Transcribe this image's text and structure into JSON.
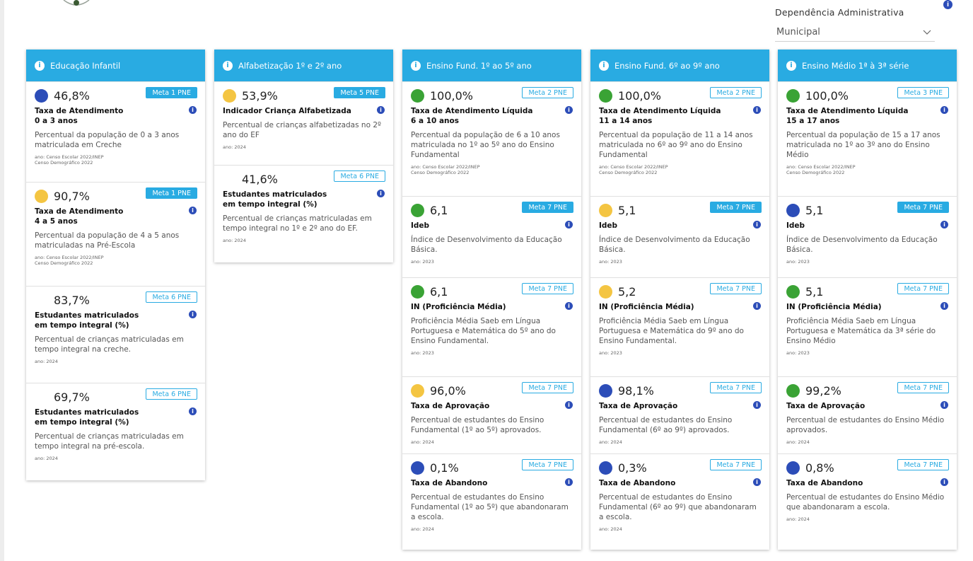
{
  "colors": {
    "header_bg": "#29abe2",
    "green": "#3aa335",
    "yellow": "#f4c542",
    "blue": "#2c4db8",
    "info": "#2c4db8"
  },
  "filter": {
    "label": "Dependência Administrativa",
    "value": "Municipal"
  },
  "columns": [
    {
      "title": "Educação Infantil",
      "cards": [
        {
          "value": "46,8%",
          "dot": "blue",
          "meta": "Meta 1 PNE",
          "meta_style": "filled",
          "title": "Taxa de Atendimento",
          "subtitle": "0 a 3 anos",
          "desc": "Percentual da população de 0 a 3 anos matriculada em Creche",
          "src1": "ano: Censo Escolar 2022/INEP",
          "src2": "Censo Demográfico 2022"
        },
        {
          "value": "90,7%",
          "dot": "yellow",
          "meta": "Meta 1 PNE",
          "meta_style": "filled",
          "title": "Taxa de Atendimento",
          "subtitle": "4 a 5 anos",
          "desc": "Percentual da população de 4 a 5 anos matriculadas na Pré-Escola",
          "src1": "ano: Censo Escolar 2022/INEP",
          "src2": "Censo Demográfico 2022"
        },
        {
          "value": "83,7%",
          "dot": "none",
          "meta": "Meta 6 PNE",
          "meta_style": "outline",
          "title": "Estudantes matriculados",
          "subtitle": "em tempo integral (%)",
          "desc": "Percentual de crianças matriculadas em tempo integral na creche.",
          "src1": "ano: 2024",
          "src2": ""
        },
        {
          "value": "69,7%",
          "dot": "none",
          "meta": "Meta 6 PNE",
          "meta_style": "outline",
          "title": "Estudantes matriculados",
          "subtitle": "em tempo integral (%)",
          "desc": "Percentual de crianças matriculadas em tempo integral na pré-escola.",
          "src1": "ano: 2024",
          "src2": ""
        }
      ]
    },
    {
      "title": "Alfabetização 1º e 2º ano",
      "cards": [
        {
          "value": "53,9%",
          "dot": "yellow",
          "meta": "Meta 5 PNE",
          "meta_style": "filled",
          "title": "Indicador Criança Alfabetizada",
          "subtitle": "",
          "desc": "Percentual de crianças alfabetizadas no 2º ano do EF",
          "src1": "ano: 2024",
          "src2": ""
        },
        {
          "value": "41,6%",
          "dot": "none",
          "meta": "Meta 6 PNE",
          "meta_style": "outline",
          "title": "Estudantes matriculados",
          "subtitle": "em tempo integral (%)",
          "desc": "Percentual de crianças matriculadas em tempo integral no 1º e 2º ano do EF.",
          "src1": "ano: 2024",
          "src2": ""
        }
      ]
    },
    {
      "title": "Ensino Fund. 1º ao 5º ano",
      "cards": [
        {
          "value": "100,0%",
          "dot": "green",
          "meta": "Meta 2 PNE",
          "meta_style": "outline",
          "title": "Taxa de Atendimento Líquida",
          "subtitle": "6 a 10 anos",
          "desc": "Percentual da população de 6 a 10 anos matriculada no 1º ao 5º ano do Ensino Fundamental",
          "src1": "ano: Censo Escolar 2022/INEP",
          "src2": "Censo Demográfico 2022"
        },
        {
          "value": "6,1",
          "dot": "green",
          "meta": "Meta 7 PNE",
          "meta_style": "filled",
          "title": "Ideb",
          "subtitle": "",
          "desc": "Índice de Desenvolvimento da Educação Básica.",
          "src1": "ano: 2023",
          "src2": ""
        },
        {
          "value": "6,1",
          "dot": "green",
          "meta": "Meta 7 PNE",
          "meta_style": "outline",
          "title": "IN (Proficiência Média)",
          "subtitle": "",
          "desc": "Proficiência Média Saeb em Língua Portuguesa e Matemática do 5º ano do Ensino Fundamental.",
          "src1": "ano: 2023",
          "src2": ""
        },
        {
          "value": "96,0%",
          "dot": "yellow",
          "meta": "Meta 7 PNE",
          "meta_style": "outline",
          "title": "Taxa de Aprovação",
          "subtitle": "",
          "desc": "Percentual de estudantes do Ensino Fundamental (1º ao 5º) aprovados.",
          "src1": "ano: 2024",
          "src2": ""
        },
        {
          "value": "0,1%",
          "dot": "blue",
          "meta": "Meta 7 PNE",
          "meta_style": "outline",
          "title": "Taxa de Abandono",
          "subtitle": "",
          "desc": "Percentual de estudantes do Ensino Fundamental (1º ao 5º) que abandonaram a escola.",
          "src1": "ano: 2024",
          "src2": ""
        }
      ]
    },
    {
      "title": "Ensino Fund. 6º ao 9º ano",
      "cards": [
        {
          "value": "100,0%",
          "dot": "green",
          "meta": "Meta 2 PNE",
          "meta_style": "outline",
          "title": "Taxa de Atendimento Líquida",
          "subtitle": "11 a 14 anos",
          "desc": "Percentual da população de 11 a 14 anos matriculada no 6º ao 9º ano do Ensino Fundamental",
          "src1": "ano: Censo Escolar 2022/INEP",
          "src2": "Censo Demográfico 2022"
        },
        {
          "value": "5,1",
          "dot": "yellow",
          "meta": "Meta 7 PNE",
          "meta_style": "filled",
          "title": "Ideb",
          "subtitle": "",
          "desc": "Índice de Desenvolvimento da Educação Básica.",
          "src1": "ano: 2023",
          "src2": ""
        },
        {
          "value": "5,2",
          "dot": "yellow",
          "meta": "Meta 7 PNE",
          "meta_style": "outline",
          "title": "IN (Proficiência Média)",
          "subtitle": "",
          "desc": "Proficiência Média Saeb em Língua Portuguesa e Matemática do 9º ano do Ensino Fundamental.",
          "src1": "ano: 2023",
          "src2": ""
        },
        {
          "value": "98,1%",
          "dot": "blue",
          "meta": "Meta 7 PNE",
          "meta_style": "outline",
          "title": "Taxa de Aprovação",
          "subtitle": "",
          "desc": "Percentual de estudantes do Ensino Fundamental (6º ao 9º) aprovados.",
          "src1": "ano: 2024",
          "src2": ""
        },
        {
          "value": "0,3%",
          "dot": "blue",
          "meta": "Meta 7 PNE",
          "meta_style": "outline",
          "title": "Taxa de Abandono",
          "subtitle": "",
          "desc": "Percentual de estudantes do Ensino Fundamental (6º ao 9º) que abandonaram a escola.",
          "src1": "ano: 2024",
          "src2": ""
        }
      ]
    },
    {
      "title": "Ensino Médio 1ª à 3ª série",
      "cards": [
        {
          "value": "100,0%",
          "dot": "green",
          "meta": "Meta 3 PNE",
          "meta_style": "outline",
          "title": "Taxa de Atendimento Líquida",
          "subtitle": "15 a 17 anos",
          "desc": "Percentual da população de 15 a 17 anos matriculada no 1º ao 3º ano do Ensino Médio",
          "src1": "ano: Censo Escolar 2022/INEP",
          "src2": "Censo Demográfico 2022"
        },
        {
          "value": "5,1",
          "dot": "blue",
          "meta": "Meta 7 PNE",
          "meta_style": "filled",
          "title": "Ideb",
          "subtitle": "",
          "desc": "Índice de Desenvolvimento da Educação Básica.",
          "src1": "ano: 2023",
          "src2": ""
        },
        {
          "value": "5,1",
          "dot": "green",
          "meta": "Meta 7 PNE",
          "meta_style": "outline",
          "title": "IN (Proficiência Média)",
          "subtitle": "",
          "desc": "Proficiência Média Saeb em Língua Portuguesa e Matemática da 3ª série do Ensino Médio",
          "src1": "ano: 2023",
          "src2": ""
        },
        {
          "value": "99,2%",
          "dot": "green",
          "meta": "Meta 7 PNE",
          "meta_style": "outline",
          "title": "Taxa de Aprovação",
          "subtitle": "",
          "desc": "Percentual de estudantes do Ensino Médio aprovados.",
          "src1": "ano: 2024",
          "src2": ""
        },
        {
          "value": "0,8%",
          "dot": "blue",
          "meta": "Meta 7 PNE",
          "meta_style": "outline",
          "title": "Taxa de Abandono",
          "subtitle": "",
          "desc": "Percentual de estudantes do Ensino Médio que abandonaram a escola.",
          "src1": "ano: 2024",
          "src2": ""
        }
      ]
    }
  ]
}
